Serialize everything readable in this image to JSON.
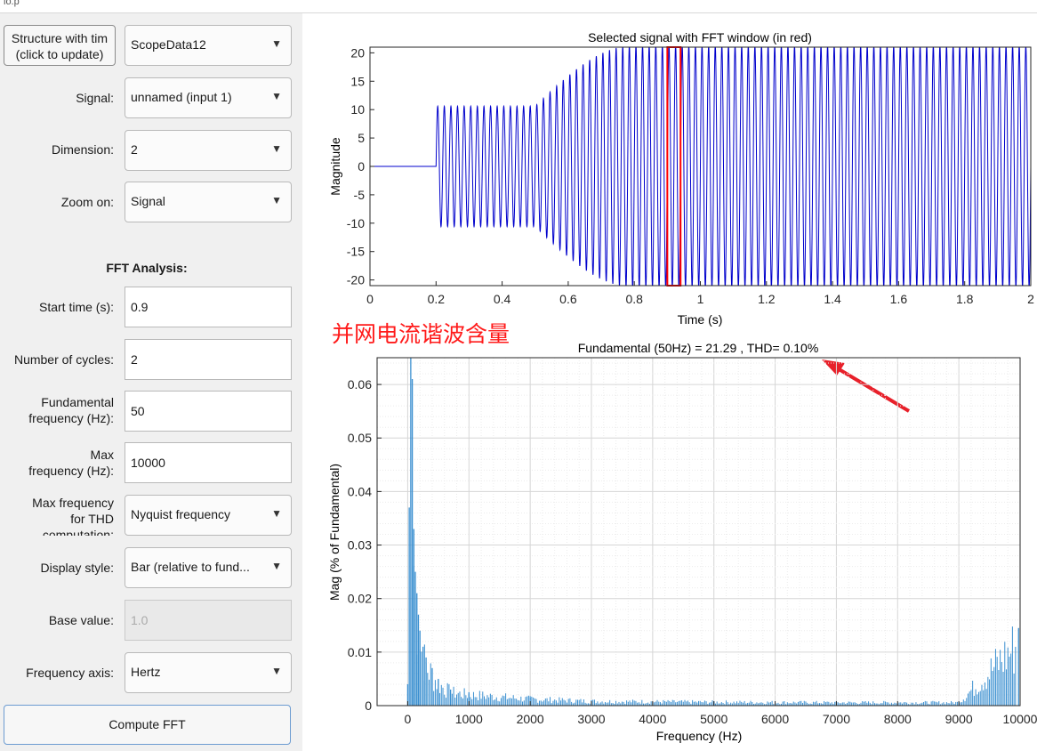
{
  "window": {
    "title": "lo.p"
  },
  "panel": {
    "structure_button": "Structure with tim\n(click to update)",
    "structure_dropdown": "ScopeData12",
    "signal_label": "Signal:",
    "signal_value": "unnamed (input 1)",
    "dimension_label": "Dimension:",
    "dimension_value": "2",
    "zoom_label": "Zoom on:",
    "zoom_value": "Signal",
    "fft_heading": "FFT Analysis:",
    "start_time_label": "Start time (s):",
    "start_time_value": "0.9",
    "cycles_label": "Number of cycles:",
    "cycles_value": "2",
    "fund_freq_label": "Fundamental\nfrequency (Hz):",
    "fund_freq_value": "50",
    "max_freq_label": "Max\nfrequency (Hz):",
    "max_freq_value": "10000",
    "thd_label": "Max frequency\nfor THD\ncomputation:",
    "thd_value": "Nyquist frequency",
    "display_label": "Display style:",
    "display_value": "Bar (relative to fund...",
    "base_label": "Base value:",
    "base_value": "1.0",
    "freq_axis_label": "Frequency axis:",
    "freq_axis_value": "Hertz",
    "compute_button": "Compute FFT"
  },
  "annotation": {
    "text": "并网电流谐波含量",
    "color": "#ff1a1a",
    "arrow_color": "#e8202a"
  },
  "colors": {
    "signal": "#0000cc",
    "fft_window": "#ff0000",
    "bars": "#3a8fd0"
  },
  "chart_data": [
    {
      "type": "line",
      "title": "Selected signal with FFT window (in red)",
      "xlabel": "Time (s)",
      "ylabel": "Magnitude",
      "xlim": [
        0,
        2
      ],
      "ylim": [
        -21,
        21
      ],
      "xticks": [
        "0",
        "0.2",
        "0.4",
        "0.6",
        "0.8",
        "1",
        "1.2",
        "1.4",
        "1.6",
        "1.8",
        "2"
      ],
      "yticks": [
        "20",
        "15",
        "10",
        "5",
        "0",
        "-5",
        "-10",
        "-15",
        "-20"
      ],
      "grid": false,
      "series": [
        {
          "name": "",
          "frequency_hz": 50,
          "segments": [
            {
              "t_start": 0,
              "t_end": 0.2,
              "amplitude": 0
            },
            {
              "t_start": 0.2,
              "t_end": 0.5,
              "amplitude": 10.6
            },
            {
              "t_start": 0.5,
              "t_end": 0.8,
              "amplitude_from": 10.6,
              "amplitude_to": 21.29
            },
            {
              "t_start": 0.8,
              "t_end": 2,
              "amplitude": 21.29
            }
          ]
        },
        {
          "name": "",
          "fft_window": [
            0.9,
            0.94
          ]
        }
      ]
    },
    {
      "type": "bar",
      "title": "Fundamental (50Hz) = 21.29 , THD= 0.10%",
      "xlabel": "Frequency (Hz)",
      "ylabel": "Mag (% of Fundamental)",
      "xlim": [
        -500,
        10000
      ],
      "ylim": [
        0,
        0.065
      ],
      "xticks": [
        "0",
        "1000",
        "2000",
        "3000",
        "4000",
        "5000",
        "6000",
        "7000",
        "8000",
        "9000",
        "10000"
      ],
      "yticks": [
        "0.06",
        "0.05",
        "0.04",
        "0.03",
        "0.02",
        "0.01",
        "0"
      ],
      "grid": true,
      "values": [
        {
          "x": 0,
          "y": 0.004
        },
        {
          "x": 25,
          "y": 0.037
        },
        {
          "x": 50,
          "y": 0.065
        },
        {
          "x": 75,
          "y": 0.061
        },
        {
          "x": 100,
          "y": 0.033
        },
        {
          "x": 125,
          "y": 0.025
        },
        {
          "x": 150,
          "y": 0.021
        },
        {
          "x": 175,
          "y": 0.017
        },
        {
          "x": 200,
          "y": 0.014
        },
        {
          "x": 250,
          "y": 0.011
        },
        {
          "x": 300,
          "y": 0.009
        },
        {
          "x": 400,
          "y": 0.007
        },
        {
          "x": 500,
          "y": 0.005
        },
        {
          "x": 700,
          "y": 0.003
        },
        {
          "x": 1000,
          "y": 0.0025
        },
        {
          "x": 2000,
          "y": 0.0015
        },
        {
          "x": 3000,
          "y": 0.001
        },
        {
          "x": 5000,
          "y": 0.0008
        },
        {
          "x": 7000,
          "y": 0.0007
        },
        {
          "x": 9000,
          "y": 0.0007
        },
        {
          "x": 9975,
          "y": 0.0145
        }
      ]
    }
  ]
}
